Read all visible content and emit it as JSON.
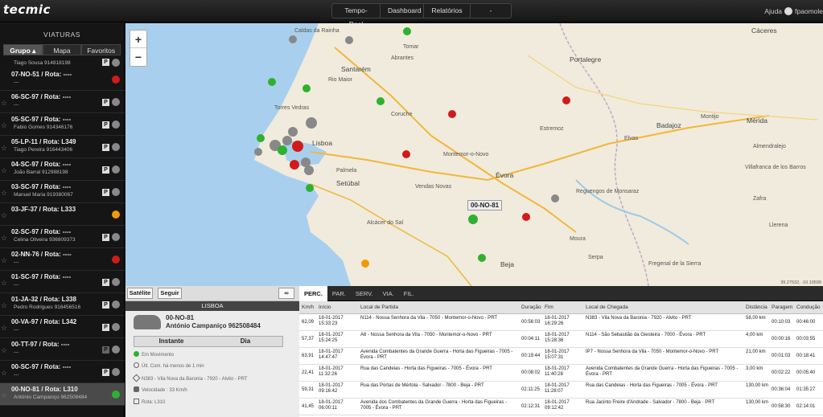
{
  "app": {
    "logo": "tecmic"
  },
  "nav": {
    "items": [
      "Tempo-Real",
      "Dashboard",
      "Relatórios",
      "-"
    ]
  },
  "top_right": {
    "help": "Ajuda",
    "user": "fpaomole"
  },
  "left_panel": {
    "title": "VIATURAS",
    "tabs": [
      "Grupo",
      "Mapa",
      "Favoritos"
    ],
    "first_sub": "Tiago Sousa 914818198",
    "vehicles": [
      {
        "title": "07-NO-51 / Rota: ----",
        "sub": "---"
      },
      {
        "title": "06-SC-97 / Rota: ----",
        "sub": "---"
      },
      {
        "title": "05-SC-97 / Rota: ----",
        "sub": "Fabio Gomes 914346176"
      },
      {
        "title": "05-LP-11 / Rota: L349",
        "sub": "Tiago Pereira 916443406"
      },
      {
        "title": "04-SC-97 / Rota: ----",
        "sub": "João Barral 912988198"
      },
      {
        "title": "03-SC-97 / Rota: ----",
        "sub": "Manuel Maria 919380067"
      },
      {
        "title": "03-JF-37 / Rota: L333",
        "sub": ""
      },
      {
        "title": "02-SC-97 / Rota: ----",
        "sub": "Celina Oliveira 936809373"
      },
      {
        "title": "02-NN-76 / Rota: ----",
        "sub": "---"
      },
      {
        "title": "01-SC-97 / Rota: ----",
        "sub": "---"
      },
      {
        "title": "01-JA-32 / Rota: L338",
        "sub": "Pedro Rodrigues 916456516"
      },
      {
        "title": "00-VA-97 / Rota: L342",
        "sub": "---"
      },
      {
        "title": "00-TT-97 / Rota: ----",
        "sub": "---"
      },
      {
        "title": "00-SC-97 / Rota: ----",
        "sub": "---"
      },
      {
        "title": "00-NO-81 / Rota: L310",
        "sub": "António Campaniço 962508484"
      }
    ]
  },
  "map": {
    "zoom_in": "+",
    "zoom_out": "−",
    "selected_pin": "00-NO-81",
    "scale_text": "39.27532, -10.10599",
    "labels": [
      "Caldas da Rainha",
      "Santarém",
      "Portalegre",
      "Cáceres",
      "Badajoz",
      "Mérida",
      "Lisboa",
      "Setúbal",
      "Évora",
      "Beja",
      "Almendralejo",
      "Zafra",
      "Estremoz",
      "Montijo",
      "Elvas",
      "Torres Vedras",
      "Abrantes",
      "Montemor-o-Novo",
      "Palmela",
      "Reguengos de Monsaraz",
      "Villafranca de los Barros",
      "Llerena",
      "Moura",
      "Serpa",
      "Fregenal de la Sierra",
      "Rio Maior",
      "Tomar",
      "Coruche",
      "Vendas Novas",
      "Alcácer do Sal"
    ]
  },
  "bottom_left": {
    "btn_satellite": "Satélite",
    "btn_follow": "Seguir",
    "location": "LISBOA",
    "vehicle_id": "00-NO-81",
    "driver": "António Campaniço 962508484",
    "tab_instant": "Instante",
    "tab_day": "Dia",
    "status": "Em Movimento",
    "last_comm": "Últ. Com. há menos de 1 min",
    "address": "N383 - Vila Nova da Baronia - 7920 - Alvito - PRT",
    "speed": "Velocidade : 33 Km/h",
    "route": "Rota: L310"
  },
  "bottom_right": {
    "tabs": [
      "PERC.",
      "PAR.",
      "SERV.",
      "VIA.",
      "FIL."
    ],
    "headers": [
      "Km/h",
      "Início",
      "Local de Partida",
      "Duração",
      "Fim",
      "Local de Chegada",
      "Distância",
      "Paragem",
      "Condução"
    ],
    "rows": [
      [
        "62,09",
        "18-01-2017 15:33:23",
        "N114 - Nossa Senhora da Vila - 7050 - Montemor-o-Novo - PRT",
        "00:56:03",
        "18-01-2017 16:29:26",
        "N383 - Vila Nova da Baronia - 7920 - Alvito - PRT",
        "58,00 km",
        "00:10:03",
        "00:46:00"
      ],
      [
        "57,37",
        "18-01-2017 15:24:25",
        "A6 - Nossa Senhora da Vila - 7050 - Montemor-o-Novo - PRT",
        "00:04:11",
        "18-01-2017 15:28:36",
        "N114 - São Sebastião da Giesteira - 7000 - Évora - PRT",
        "4,00 km",
        "00:00:16",
        "00:03:55"
      ],
      [
        "63,91",
        "18-01-2017 14:47:47",
        "Avenida Combatentes da Grande Guerra - Horta das Figueiras - 7005 - Évora - PRT",
        "00:19:44",
        "18-01-2017 15:07:31",
        "IP7 - Nossa Senhora da Vila - 7050 - Montemor-o-Novo - PRT",
        "21,00 km",
        "00:01:03",
        "00:18:41"
      ],
      [
        "22,41",
        "18-01-2017 11:32:26",
        "Rua das Candeias - Horta das Figueiras - 7005 - Évora - PRT",
        "00:08:02",
        "18-01-2017 11:40:28",
        "Avenida Combatentes da Grande Guerra - Horta das Figueiras - 7005 - Évora - PRT",
        "3,00 km",
        "00:02:22",
        "00:05:40"
      ],
      [
        "59,31",
        "18-01-2017 09:16:42",
        "Rua das Portas de Mértola - Salvador - 7800 - Beja - PRT",
        "02:11:25",
        "18-01-2017 11:28:07",
        "Rua das Candeias - Horta das Figueiras - 7005 - Évora - PRT",
        "130,00 km",
        "00:36:04",
        "01:35:27"
      ],
      [
        "41,45",
        "18-01-2017 06:00:11",
        "Avenida dos Combatentes da Grande Guerra - Horta das Figueiras - 7005 - Évora - PRT",
        "02:12:31",
        "18-01-2017 09:12:42",
        "Rua Jacinto Freire d'Andrade - Salvador - 7800 - Beja - PRT",
        "130,00 km",
        "00:58:30",
        "02:14:01"
      ]
    ]
  }
}
